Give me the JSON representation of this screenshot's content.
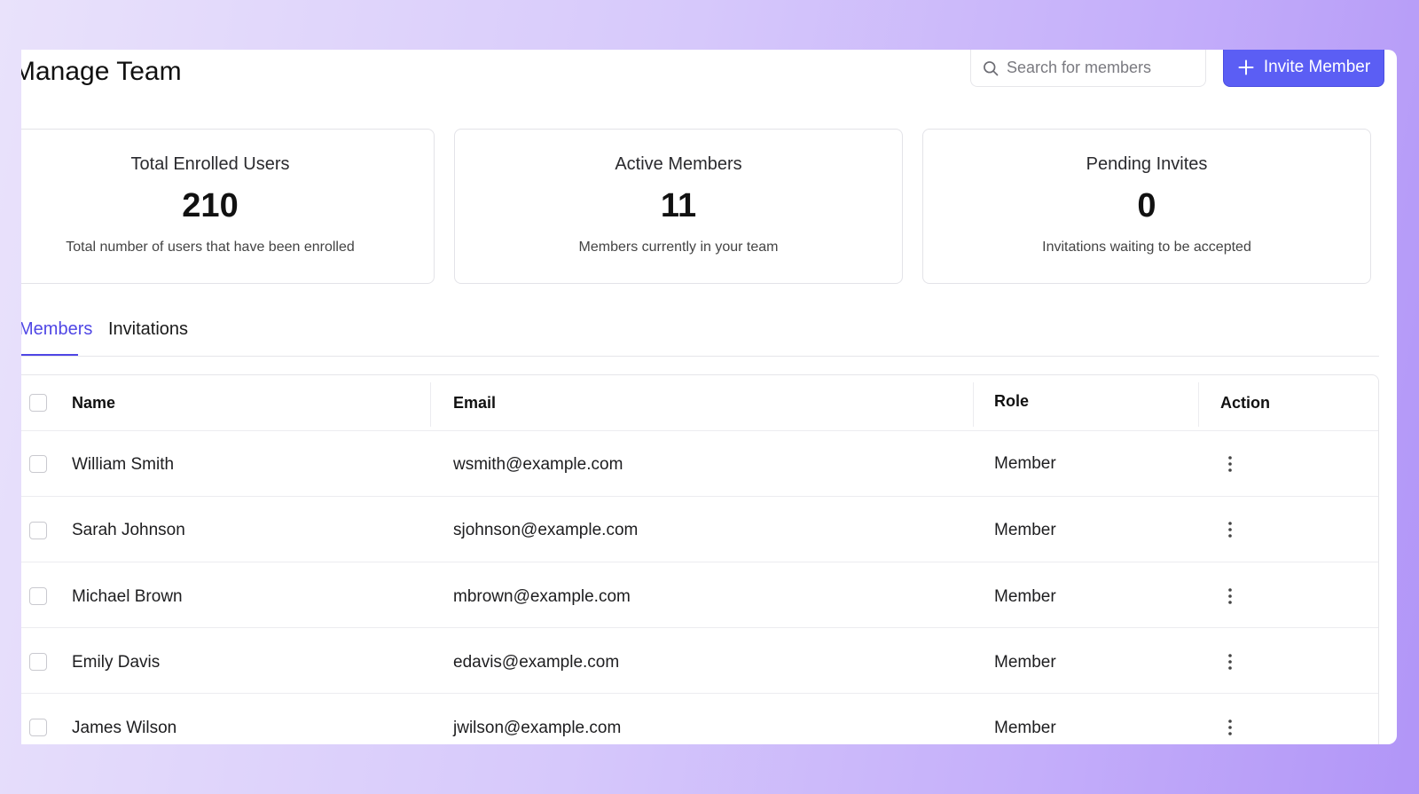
{
  "header": {
    "title": "Manage Team",
    "search_placeholder": "Search for members",
    "invite_label": "Invite Member"
  },
  "stats": [
    {
      "title": "Total Enrolled Users",
      "value": "210",
      "description": "Total number of users that have been enrolled"
    },
    {
      "title": "Active Members",
      "value": "11",
      "description": "Members currently in your team"
    },
    {
      "title": "Pending Invites",
      "value": "0",
      "description": "Invitations waiting to be accepted"
    }
  ],
  "tabs": [
    {
      "label": "Members",
      "active": true
    },
    {
      "label": "Invitations",
      "active": false
    }
  ],
  "table": {
    "columns": [
      "Name",
      "Email",
      "Role",
      "Action"
    ],
    "rows": [
      {
        "name": "William Smith",
        "email": "wsmith@example.com",
        "role": "Member"
      },
      {
        "name": "Sarah Johnson",
        "email": "sjohnson@example.com",
        "role": "Member"
      },
      {
        "name": "Michael Brown",
        "email": "mbrown@example.com",
        "role": "Member"
      },
      {
        "name": "Emily Davis",
        "email": "edavis@example.com",
        "role": "Member"
      },
      {
        "name": "James Wilson",
        "email": "jwilson@example.com",
        "role": "Member"
      }
    ]
  },
  "colors": {
    "accent": "#5b5ef4",
    "active_tab": "#4f46e5"
  }
}
